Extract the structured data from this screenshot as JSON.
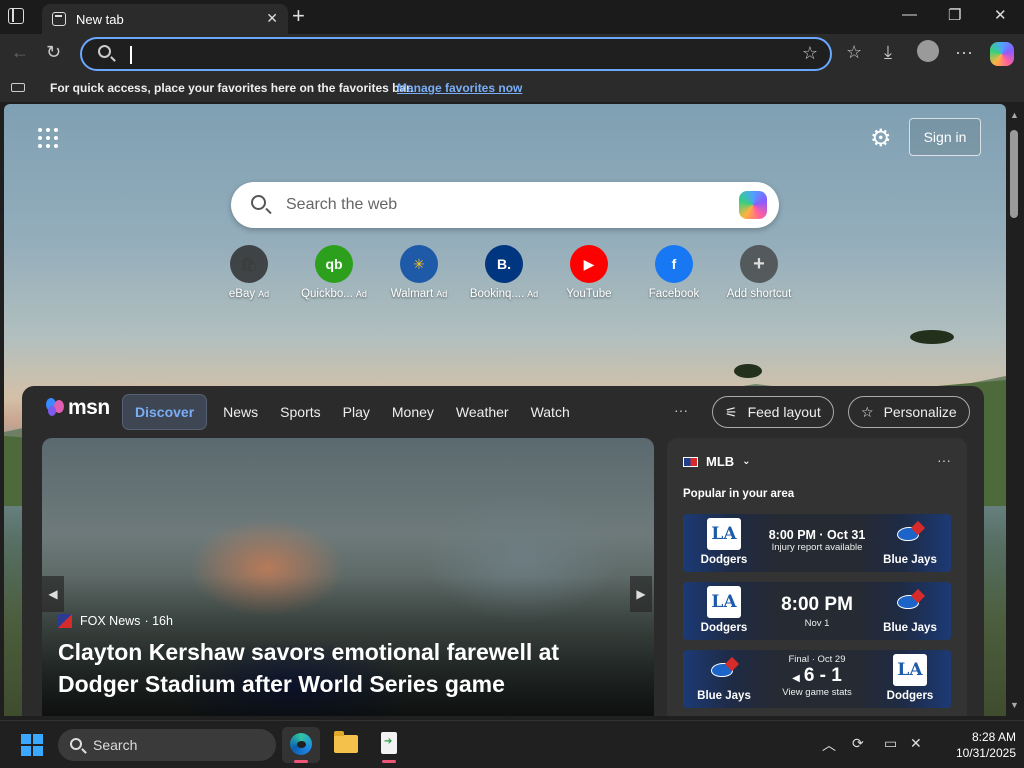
{
  "browser": {
    "tab_title": "New tab",
    "tab_close": "✕",
    "new_tab": "+",
    "window_controls": {
      "minimize": "—",
      "restore": "❐",
      "close": "✕"
    },
    "address": {
      "value": "",
      "placeholder": ""
    },
    "favorites_bar": {
      "text": "For quick access, place your favorites here on the favorites bar.",
      "link": "Manage favorites now"
    }
  },
  "newtab": {
    "sign_in": "Sign in",
    "search_placeholder": "Search the web",
    "quick_links": [
      {
        "label": "eBay",
        "ad": "Ad",
        "icon": "ebay-icon",
        "color": "#3d3d3d"
      },
      {
        "label": "Quickbo...",
        "ad": "Ad",
        "icon": "quickbooks-icon",
        "color": "#2ca01c"
      },
      {
        "label": "Walmart",
        "ad": "Ad",
        "icon": "walmart-icon",
        "color": "#0071ce"
      },
      {
        "label": "Bookinq....",
        "ad": "Ad",
        "icon": "booking-icon",
        "color": "#003580"
      },
      {
        "label": "YouTube",
        "ad": "",
        "icon": "youtube-icon",
        "color": "#ff0000"
      },
      {
        "label": "Facebook",
        "ad": "",
        "icon": "facebook-icon",
        "color": "#1877f2"
      },
      {
        "label": "Add shortcut",
        "ad": "",
        "icon": "add-icon",
        "color": "#666666"
      }
    ],
    "quick_glyphs": [
      "🛍",
      "qb",
      "✳",
      "B.",
      "▶",
      "f",
      "+"
    ]
  },
  "feed": {
    "brand": "msn",
    "nav": [
      "Discover",
      "News",
      "Sports",
      "Play",
      "Money",
      "Weather",
      "Watch"
    ],
    "more": "···",
    "feed_layout": "Feed layout",
    "personalize": "Personalize",
    "hero": {
      "source": "FOX News",
      "age": "· 16h",
      "headline": "Clayton Kershaw savors emotional farewell at Dodger Stadium after World Series game"
    },
    "mlb": {
      "title": "MLB",
      "popular": "Popular in your area",
      "games": [
        {
          "left": "Dodgers",
          "right": "Blue Jays",
          "line1": "8:00 PM · Oct 31",
          "line2": "Injury report available",
          "left_logo": "LA",
          "right_logo": "bluejays"
        },
        {
          "left": "Dodgers",
          "right": "Blue Jays",
          "line1": "8:00 PM",
          "line2": "Nov 1",
          "left_logo": "LA",
          "right_logo": "bluejays"
        },
        {
          "left": "Blue Jays",
          "right": "Dodgers",
          "line0": "Final · Oct 29",
          "line1": "6 - 1",
          "line2": "View game stats",
          "left_logo": "bluejays",
          "right_logo": "LA"
        }
      ]
    }
  },
  "taskbar": {
    "search": "Search",
    "time": "8:28 AM",
    "date": "10/31/2025"
  },
  "colors": {
    "accent": "#6aa7ff",
    "link": "#79aef7",
    "msn_active": "#79aef7"
  }
}
